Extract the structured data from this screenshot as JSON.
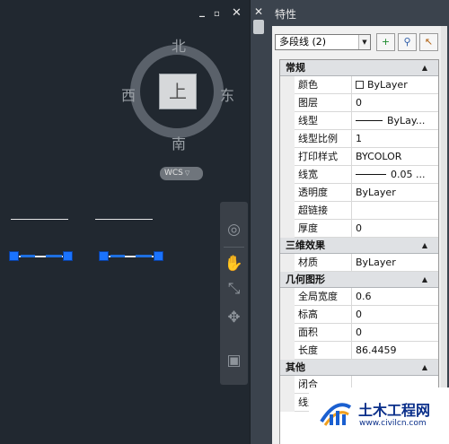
{
  "viewport": {
    "controls": {
      "minimize": "_",
      "restore": "▫",
      "close": "✕"
    },
    "viewcube": {
      "north": "北",
      "south": "南",
      "west": "西",
      "east": "东",
      "top_face": "上",
      "wcs_label": "WCS",
      "wcs_menu_icon": "▽"
    },
    "navbar": {
      "icons": [
        "steering-wheel-icon",
        "pan-icon",
        "zoom-extents-icon",
        "orbit-icon",
        "showmotion-icon"
      ],
      "glyphs": [
        "◎",
        "✋",
        "⤡",
        "✥",
        "▣"
      ]
    },
    "colors": {
      "background": "#212830",
      "grip": "#1a73ff",
      "selection": "#1e6fe0"
    }
  },
  "palette": {
    "title": "特性",
    "close": "✕",
    "object_selector": {
      "value": "多段线 (2)",
      "arrow": "▼"
    },
    "toolbar": {
      "toggle_pickadd": "+",
      "quick_select": "⚲",
      "select_objects": "↖"
    },
    "categories": [
      {
        "title": "常规",
        "collapse_glyph": "▲",
        "rows": [
          {
            "name": "颜色",
            "value": "ByLayer"
          },
          {
            "name": "图层",
            "value": "0"
          },
          {
            "name": "线型",
            "value": "ByLay..."
          },
          {
            "name": "线型比例",
            "value": "1"
          },
          {
            "name": "打印样式",
            "value": "BYCOLOR"
          },
          {
            "name": "线宽",
            "value": "0.05 ..."
          },
          {
            "name": "透明度",
            "value": "ByLayer"
          },
          {
            "name": "超链接",
            "value": ""
          },
          {
            "name": "厚度",
            "value": "0"
          }
        ]
      },
      {
        "title": "三维效果",
        "collapse_glyph": "▲",
        "rows": [
          {
            "name": "材质",
            "value": "ByLayer"
          }
        ]
      },
      {
        "title": "几何图形",
        "collapse_glyph": "▲",
        "rows": [
          {
            "name": "全局宽度",
            "value": "0.6"
          },
          {
            "name": "标高",
            "value": "0"
          },
          {
            "name": "面积",
            "value": "0"
          },
          {
            "name": "长度",
            "value": "86.4459"
          }
        ]
      },
      {
        "title": "其他",
        "collapse_glyph": "▲",
        "rows": [
          {
            "name": "闭合",
            "value": ""
          },
          {
            "name": "线型生成",
            "value": ""
          }
        ]
      }
    ]
  },
  "watermark": {
    "name": "土木工程网",
    "url": "www.civilcn.com"
  }
}
